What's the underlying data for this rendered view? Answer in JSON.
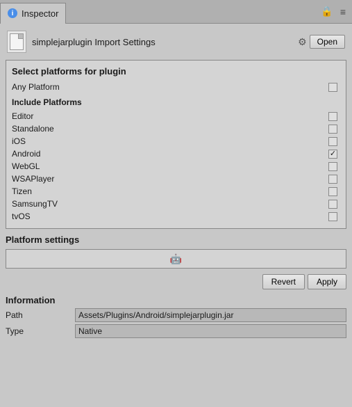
{
  "titleBar": {
    "tabLabel": "Inspector",
    "infoIconLabel": "i"
  },
  "fileHeader": {
    "fileName": "simplejarplugin Import Settings",
    "openButtonLabel": "Open"
  },
  "platformsSection": {
    "title": "Select platforms for plugin",
    "anyPlatformLabel": "Any Platform",
    "anyPlatformChecked": false,
    "includeTitle": "Include Platforms",
    "platforms": [
      {
        "name": "Editor",
        "checked": false
      },
      {
        "name": "Standalone",
        "checked": false
      },
      {
        "name": "iOS",
        "checked": false
      },
      {
        "name": "Android",
        "checked": true
      },
      {
        "name": "WebGL",
        "checked": false
      },
      {
        "name": "WSAPlayer",
        "checked": false
      },
      {
        "name": "Tizen",
        "checked": false
      },
      {
        "name": "SamsungTV",
        "checked": false
      },
      {
        "name": "tvOS",
        "checked": false
      }
    ]
  },
  "platformSettings": {
    "title": "Platform settings",
    "androidIconLabel": "🤖"
  },
  "actionButtons": {
    "revertLabel": "Revert",
    "applyLabel": "Apply"
  },
  "information": {
    "title": "Information",
    "rows": [
      {
        "key": "Path",
        "value": "Assets/Plugins/Android/simplejarplugin.jar"
      },
      {
        "key": "Type",
        "value": "Native"
      }
    ]
  }
}
